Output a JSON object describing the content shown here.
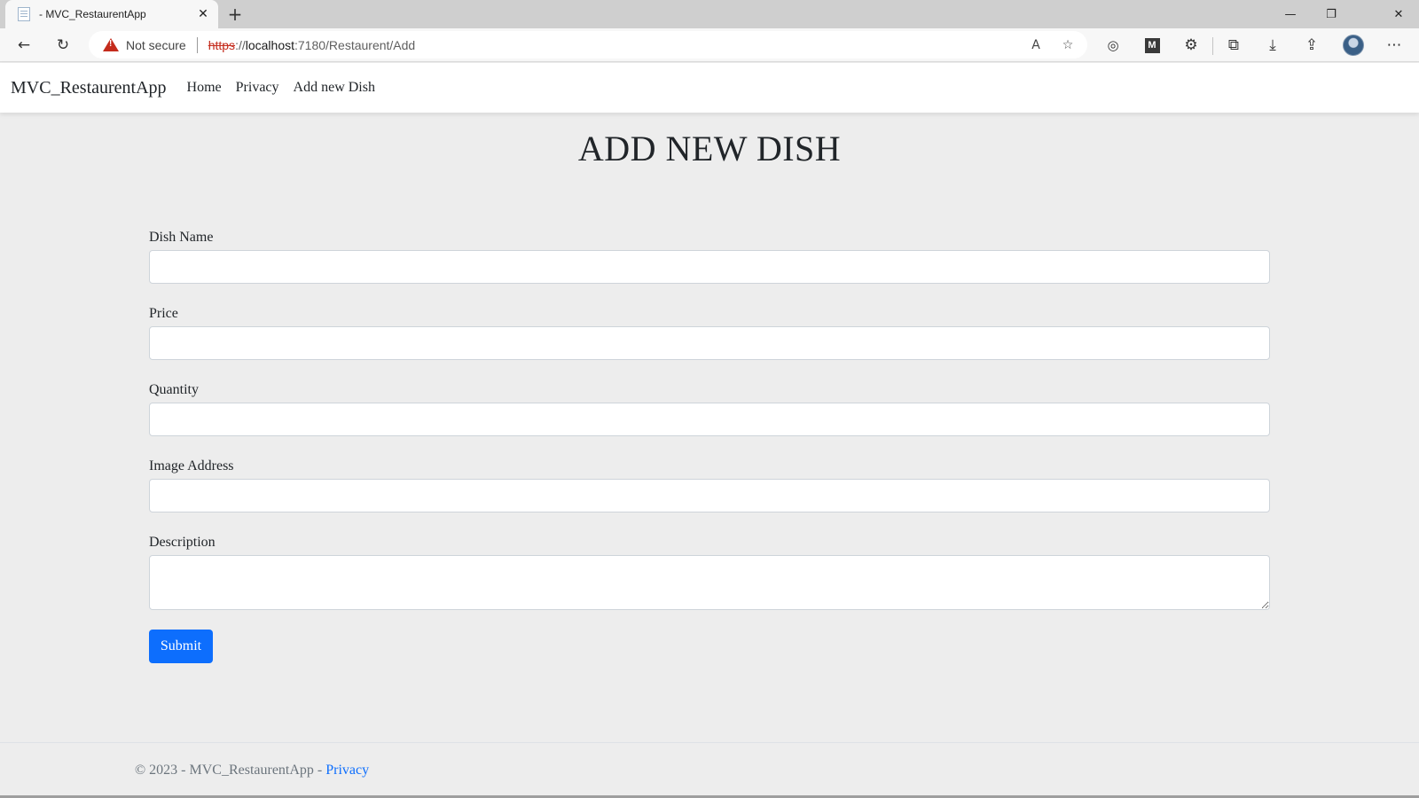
{
  "browser": {
    "tab_title": "- MVC_RestaurentApp",
    "new_tab": "+",
    "close": "✕",
    "window": {
      "minimize": "—",
      "restore": "❐",
      "close": "✕"
    },
    "address": {
      "security_label": "Not secure",
      "scheme": "https",
      "scheme_sep": "://",
      "host": "localhost",
      "path": ":7180/Restaurent/Add"
    },
    "icons": [
      "back-arrow-icon",
      "refresh-icon",
      "warning-icon",
      "read-aloud-icon",
      "favorite-add-icon",
      "browser-essentials-icon",
      "extension-m-icon",
      "extensions-icon",
      "collections-icon",
      "download-icon",
      "share-icon",
      "profile-avatar-icon",
      "more-icon"
    ]
  },
  "navbar": {
    "brand": "MVC_RestaurentApp",
    "links": [
      "Home",
      "Privacy",
      "Add new Dish"
    ]
  },
  "page": {
    "title": "ADD NEW DISH"
  },
  "form": {
    "dish_name_label": "Dish Name",
    "price_label": "Price",
    "quantity_label": "Quantity",
    "image_label": "Image Address",
    "description_label": "Description",
    "dish_name_value": "",
    "price_value": "",
    "quantity_value": "",
    "image_value": "",
    "description_value": "",
    "submit_label": "Submit"
  },
  "footer": {
    "text": "© 2023 - MVC_RestaurentApp - ",
    "link": "Privacy"
  },
  "colors": {
    "primary": "#0d6efd",
    "page_background": "#ededed",
    "warning": "#c42b1c"
  }
}
